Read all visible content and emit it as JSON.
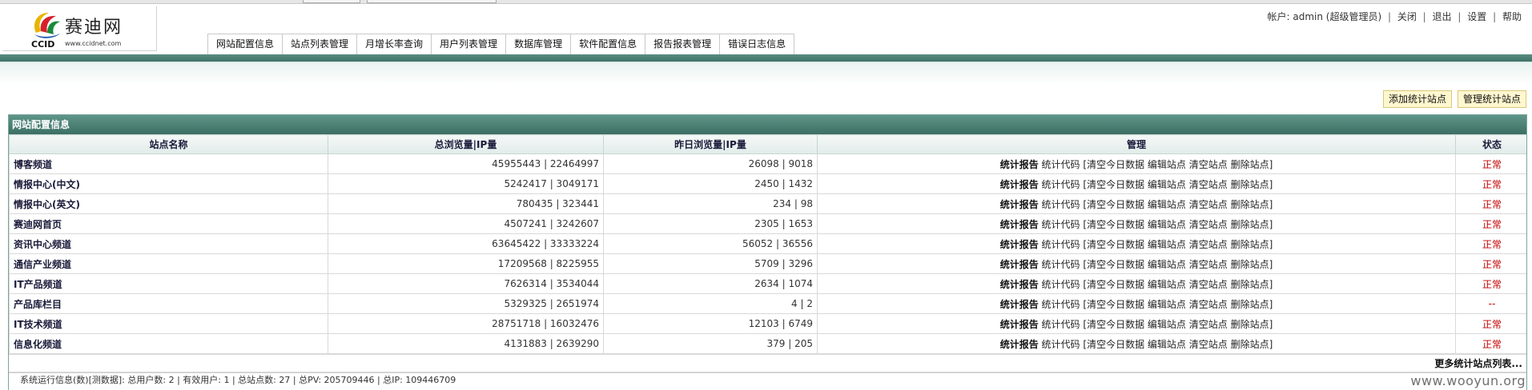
{
  "brand": {
    "name_cn": "赛迪网",
    "name_en": "CCID",
    "url": "www.ccidnet.com"
  },
  "userbar": {
    "account_label": "帐户:",
    "account": "admin (超级管理员)",
    "links": [
      "关闭",
      "退出",
      "设置",
      "帮助"
    ]
  },
  "nav": {
    "tabs": [
      "网站配置信息",
      "站点列表管理",
      "月增长率查询",
      "用户列表管理",
      "数据库管理",
      "软件配置信息",
      "报告报表管理",
      "错误日志信息"
    ]
  },
  "actions": {
    "add_site": "添加统计站点",
    "manage_sites": "管理统计站点"
  },
  "panel": {
    "title": "网站配置信息",
    "columns": [
      "站点名称",
      "总浏览量|IP量",
      "昨日浏览量|IP量",
      "管理",
      "状态"
    ],
    "manage_links": {
      "report": "统计报告",
      "code": "统计代码",
      "clear": "[清空今日数据",
      "edit": "编辑站点",
      "empty": "清空站点",
      "delete": "删除站点]"
    },
    "rows": [
      {
        "name": "博客频道",
        "total": "45955443 | 22464997",
        "yesterday": "26098 | 9018",
        "status": "正常"
      },
      {
        "name": "情报中心(中文)",
        "total": "5242417 | 3049171",
        "yesterday": "2450 | 1432",
        "status": "正常"
      },
      {
        "name": "情报中心(英文)",
        "total": "780435 | 323441",
        "yesterday": "234 | 98",
        "status": "正常"
      },
      {
        "name": "赛迪网首页",
        "total": "4507241 | 3242607",
        "yesterday": "2305 | 1653",
        "status": "正常"
      },
      {
        "name": "资讯中心频道",
        "total": "63645422 | 33333224",
        "yesterday": "56052 | 36556",
        "status": "正常"
      },
      {
        "name": "通信产业频道",
        "total": "17209568 | 8225955",
        "yesterday": "5709 | 3296",
        "status": "正常"
      },
      {
        "name": "IT产品频道",
        "total": "7626314 | 3534044",
        "yesterday": "2634 | 1074",
        "status": "正常"
      },
      {
        "name": "产品库栏目",
        "total": "5329325 | 2651974",
        "yesterday": "4 | 2",
        "status": "--"
      },
      {
        "name": "IT技术频道",
        "total": "28751718 | 16032476",
        "yesterday": "12103 | 6749",
        "status": "正常"
      },
      {
        "name": "信息化频道",
        "total": "4131883 | 2639290",
        "yesterday": "379 | 205",
        "status": "正常"
      }
    ],
    "more_link": "更多统计站点列表...",
    "footer_note": "系统运行信息(数)[测数据]: 总用户数: 2 | 有效用户: 1 | 总站点数: 27 | 总PV: 205709446 | 总IP: 109446709"
  },
  "watermark": "www.wooyun.org"
}
